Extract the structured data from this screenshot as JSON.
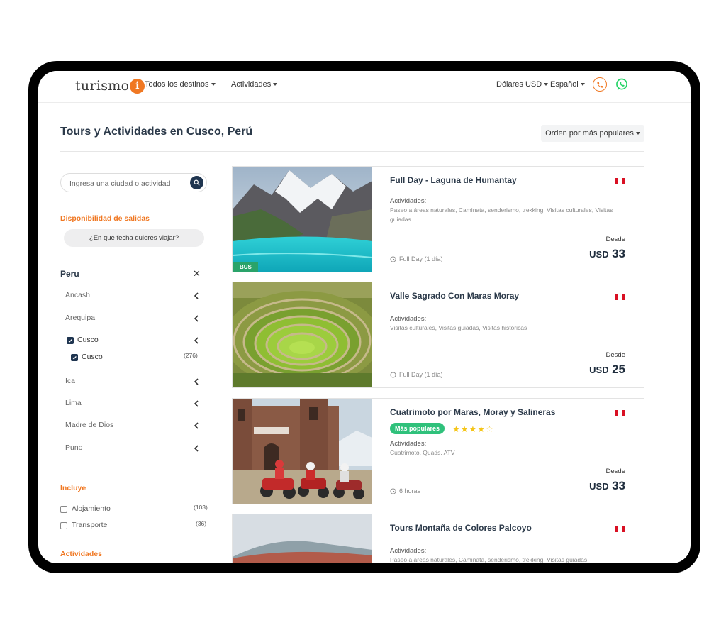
{
  "header": {
    "logo_text": "turismo",
    "logo_letter": "i",
    "nav_destinos": "Todos los destinos",
    "nav_actividades": "Actividades",
    "currency": "Dólares USD",
    "language": "Español"
  },
  "page": {
    "title": "Tours y Actividades en Cusco, Perú",
    "sort_label": "Orden por más populares"
  },
  "sidebar": {
    "search_placeholder": "Ingresa una ciudad o actividad",
    "availability_title": "Disponibilidad de salidas",
    "date_button": "¿En que fecha quieres viajar?",
    "country": "Peru",
    "country_clear": "✕",
    "regions": [
      "Ancash",
      "Arequipa",
      "Cusco",
      "Ica",
      "Lima",
      "Madre de Dios",
      "Puno"
    ],
    "sub_region": {
      "label": "Cusco",
      "count": "(276)"
    },
    "includes_title": "Incluye",
    "includes": [
      {
        "label": "Alojamiento",
        "count": "(103)"
      },
      {
        "label": "Transporte",
        "count": "(36)"
      }
    ],
    "activities_title": "Actividades"
  },
  "tours": [
    {
      "title": "Full Day - Laguna de Humantay",
      "activities_label": "Actividades:",
      "activities": "Paseo a áreas naturales, Caminata, senderismo, trekking, Visitas culturales, Visitas guiadas",
      "duration": "Full Day (1 día)",
      "from_label": "Desde",
      "currency": "USD",
      "price": "33",
      "image_badge": "BUS"
    },
    {
      "title": "Valle Sagrado Con Maras Moray",
      "activities_label": "Actividades:",
      "activities": "Visitas culturales, Visitas guiadas, Visitas históricas",
      "duration": "Full Day (1 día)",
      "from_label": "Desde",
      "currency": "USD",
      "price": "25"
    },
    {
      "title": "Cuatrimoto por Maras, Moray y Salineras",
      "popular_badge": "Más populares",
      "rating": 4,
      "rating_max": 5,
      "activities_label": "Actividades:",
      "activities": "Cuatrimoto, Quads, ATV",
      "duration": "6 horas",
      "from_label": "Desde",
      "currency": "USD",
      "price": "33"
    },
    {
      "title": "Tours Montaña de Colores Palcoyo",
      "activities_label": "Actividades:",
      "activities": "Paseo a áreas naturales, Caminata, senderismo, trekking, Visitas guiadas"
    }
  ],
  "colors": {
    "accent": "#f07823",
    "navy": "#1f3550",
    "whatsapp": "#25d366",
    "popular": "#2fc17b",
    "star": "#f5c518"
  }
}
